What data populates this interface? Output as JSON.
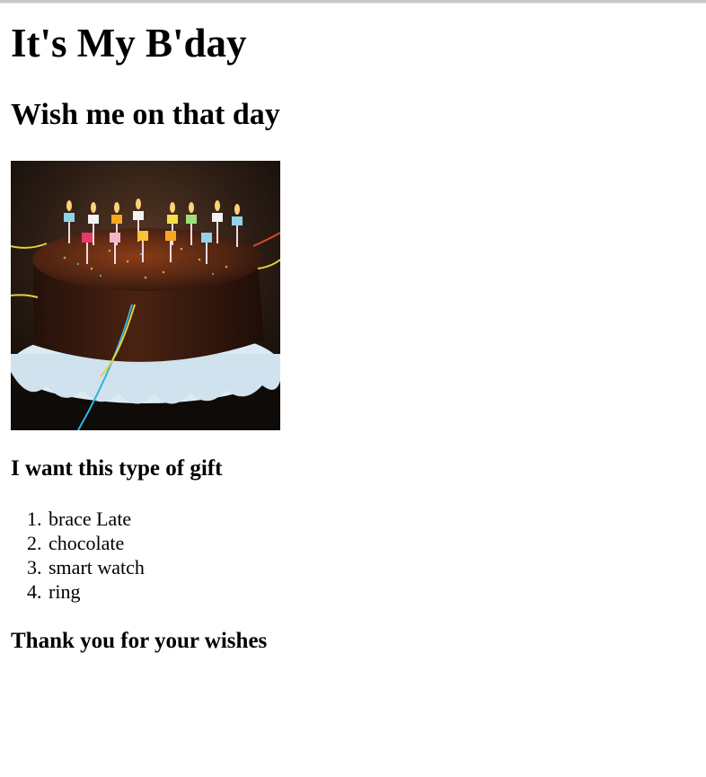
{
  "heading": "It's My B'day",
  "subheading": "Wish me on that day",
  "image": {
    "description": "birthday-cake-image",
    "colors": {
      "background": "#2a1c14",
      "cake": "#3a1d12",
      "cake_top": "#5a2a14",
      "stand": "#d6e8f2",
      "flame": "#ffd27a"
    }
  },
  "gift_heading": "I want this type of gift",
  "gifts": [
    "brace Late",
    "chocolate",
    "smart watch",
    "ring"
  ],
  "closing": "Thank you for your wishes"
}
